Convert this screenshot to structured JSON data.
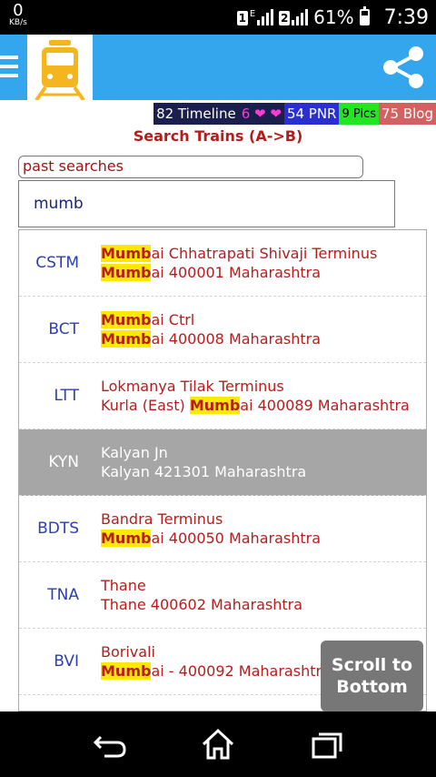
{
  "status_bar": {
    "speed_value": "0",
    "speed_unit": "KB/s",
    "sim1": "1",
    "sim1_network": "E",
    "sim2": "2",
    "battery": "61%",
    "battery_level": 0.61,
    "time": "7:39"
  },
  "app_bar": {
    "menu_icon": "hamburger-menu-icon",
    "logo_icon": "train-icon",
    "share_icon": "share-icon",
    "accent_color": "#34a6ed",
    "logo_color": "#f5b51e"
  },
  "links": {
    "timeline": "82 Timeline",
    "hearts": "6 ❤ ❤",
    "pnr": "54 PNR",
    "pics": "9 Pics",
    "blog": "75 Blog"
  },
  "title": "Search Trains (A->B)",
  "past_searches": "past searches",
  "search": {
    "value": "mumb"
  },
  "results": [
    {
      "code": "CSTM",
      "line1": [
        {
          "m": "Mumb"
        },
        {
          "t": "ai Chhatrapati Shivaji Terminus"
        }
      ],
      "line2": [
        {
          "m": "Mumb"
        },
        {
          "t": "ai 400001 Maharashtra"
        }
      ]
    },
    {
      "code": "BCT",
      "line1": [
        {
          "m": "Mumb"
        },
        {
          "t": "ai Ctrl"
        }
      ],
      "line2": [
        {
          "m": "Mumb"
        },
        {
          "t": "ai 400008 Maharashtra"
        }
      ]
    },
    {
      "code": "LTT",
      "line1": [
        {
          "t": "Lokmanya Tilak Terminus"
        }
      ],
      "line2": [
        {
          "t": "Kurla (East) "
        },
        {
          "m": "Mumb"
        },
        {
          "t": "ai 400089 Maharashtra"
        }
      ]
    },
    {
      "code": "KYN",
      "active": true,
      "line1": [
        {
          "t": "Kalyan Jn"
        }
      ],
      "line2": [
        {
          "t": "Kalyan 421301 Maharashtra"
        }
      ]
    },
    {
      "code": "BDTS",
      "line1": [
        {
          "t": "Bandra Terminus"
        }
      ],
      "line2": [
        {
          "m": "Mumb"
        },
        {
          "t": "ai 400050 Maharashtra"
        }
      ]
    },
    {
      "code": "TNA",
      "line1": [
        {
          "t": "Thane"
        }
      ],
      "line2": [
        {
          "t": "Thane 400602 Maharashtra"
        }
      ]
    },
    {
      "code": "BVI",
      "line1": [
        {
          "t": "Borivali"
        }
      ],
      "line2": [
        {
          "m": "Mumb"
        },
        {
          "t": "ai - 400092 Maharashtra"
        }
      ]
    }
  ],
  "scroll_button": {
    "line1": "Scroll to",
    "line2": "Bottom"
  },
  "nav_bar": {
    "back_icon": "back-icon",
    "home_icon": "home-icon",
    "recents_icon": "recents-icon"
  }
}
